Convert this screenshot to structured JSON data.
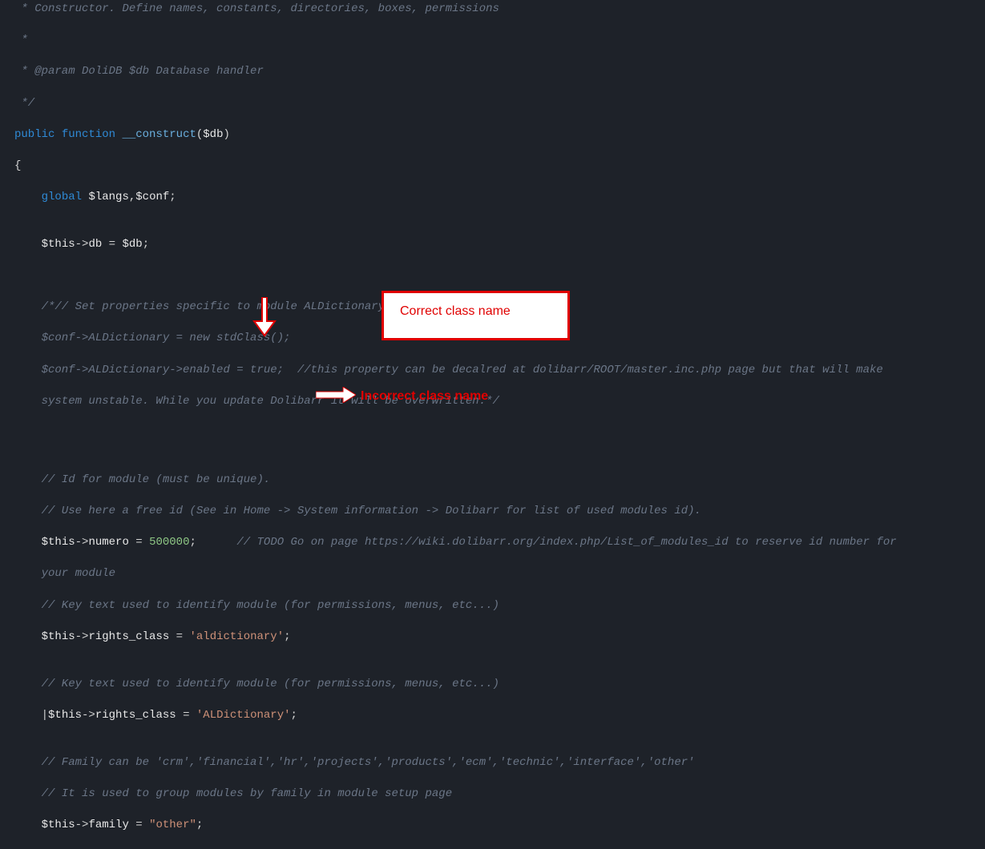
{
  "code": {
    "l1": " * Constructor. Define names, constants, directories, boxes, permissions",
    "l2": " *",
    "l3": " * @param DoliDB $db Database handler",
    "l4": " */",
    "l5_public": "public",
    "l5_function": "function",
    "l5_name": "__construct",
    "l5_paren_open": "(",
    "l5_var": "$db",
    "l5_paren_close": ")",
    "l6": "{",
    "l7_global": "global",
    "l7_langs": "$langs",
    "l7_comma": ",",
    "l7_conf": "$conf",
    "l7_semi": ";",
    "l8_this": "$this",
    "l8_arrow": "->",
    "l8_db": "db",
    "l8_eq": " = ",
    "l8_dbvar": "$db",
    "l8_semi": ";",
    "l9": "    /*// Set properties specific to module ALDictionary",
    "l10": "    $conf->ALDictionary = new stdClass();",
    "l11": "    $conf->ALDictionary->enabled = true;  //this property can be decalred at dolibarr/ROOT/master.inc.php page but that will make",
    "l12": "    system unstable. While you update Dolibarr it will be overwritten.*/",
    "l13": "    // Id for module (must be unique).",
    "l14": "    // Use here a free id (See in Home -> System information -> Dolibarr for list of used modules id).",
    "l15_this": "$this",
    "l15_arrow": "->",
    "l15_prop": "numero",
    "l15_eq": " = ",
    "l15_num": "500000",
    "l15_semi": ";",
    "l15_cmt": "      // TODO Go on page https://wiki.dolibarr.org/index.php/List_of_modules_id to reserve id number for",
    "l16": "    your module",
    "l17": "    // Key text used to identify module (for permissions, menus, etc...)",
    "l18_this": "$this",
    "l18_arrow": "->",
    "l18_prop": "rights_class",
    "l18_eq": " = ",
    "l18_str": "'aldictionary'",
    "l18_semi": ";",
    "l19": "    // Key text used to identify module (for permissions, menus, etc...)",
    "l20_cursor": "|",
    "l20_this": "$this",
    "l20_arrow": "->",
    "l20_prop": "rights_class",
    "l20_eq": " = ",
    "l20_str": "'ALDictionary'",
    "l20_semi": ";",
    "l21": "    // Family can be 'crm','financial','hr','projects','products','ecm','technic','interface','other'",
    "l22": "    // It is used to group modules by family in module setup page",
    "l23_this": "$this",
    "l23_arrow": "->",
    "l23_prop": "family",
    "l23_eq": " = ",
    "l23_str": "\"other\"",
    "l23_semi": ";"
  },
  "annotations": {
    "correct": "Correct class name",
    "incorrect": "Incorrect class name"
  }
}
